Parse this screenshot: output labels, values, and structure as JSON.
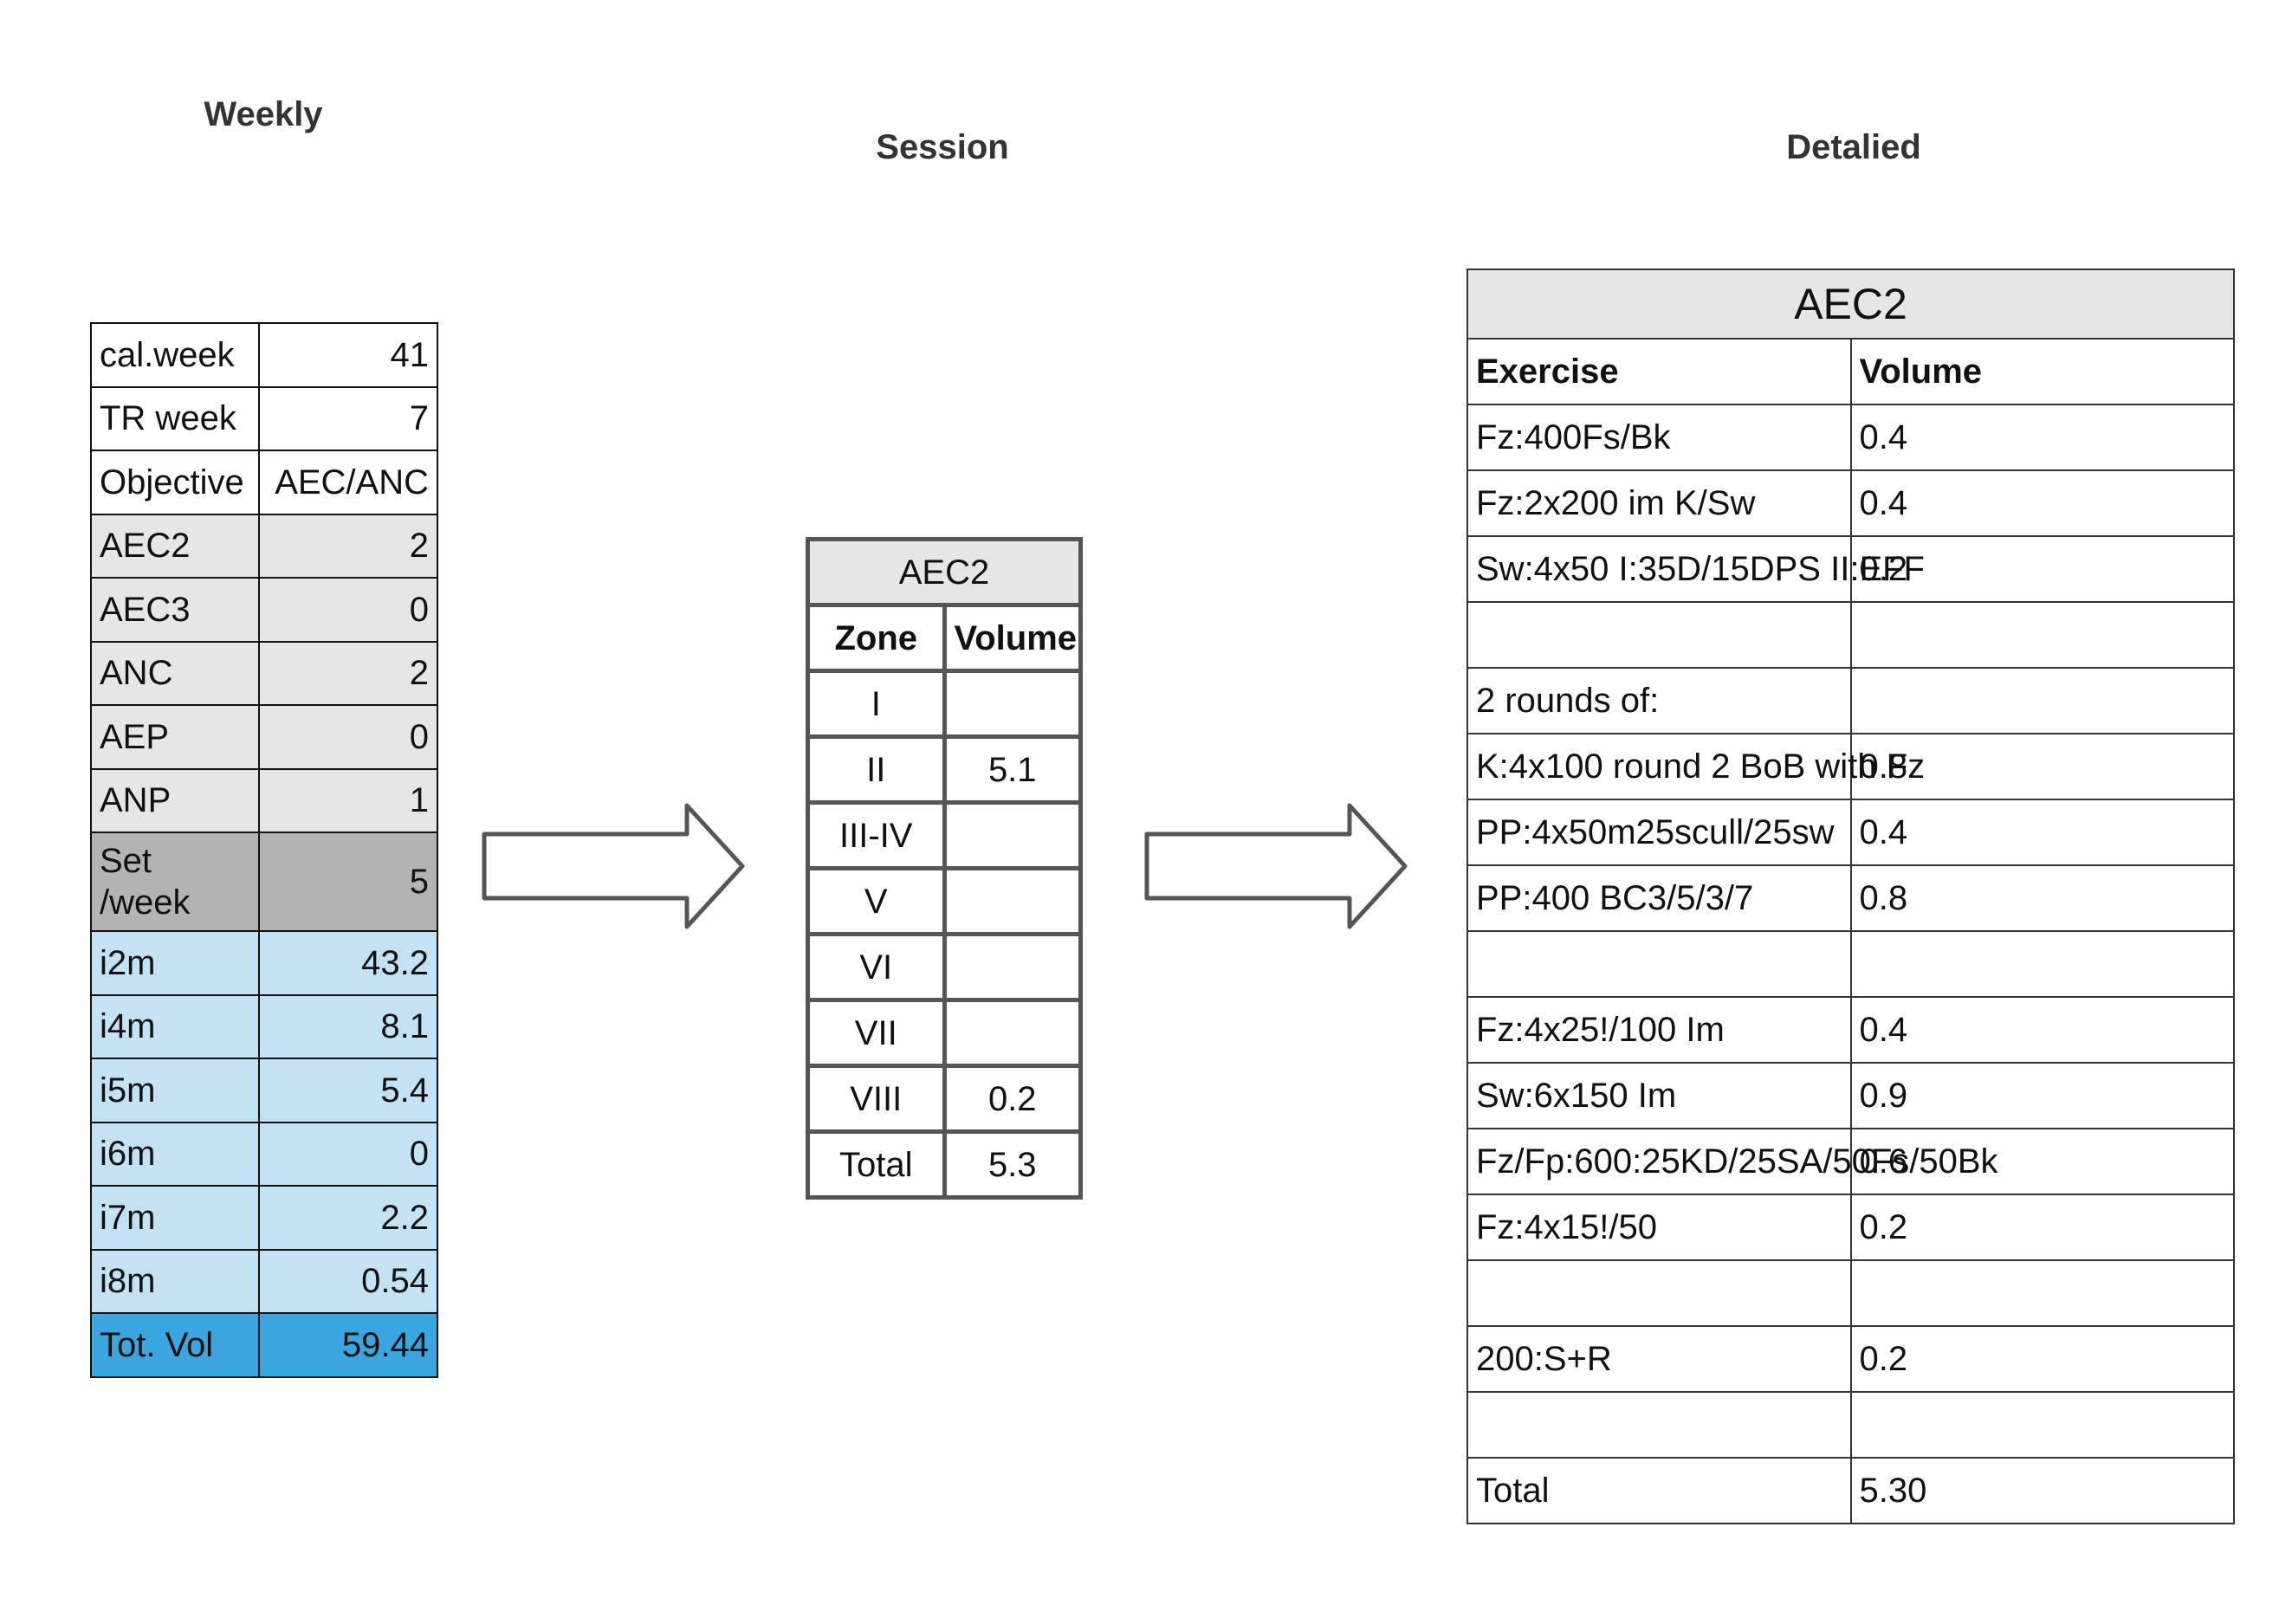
{
  "headings": {
    "weekly": "Weekly",
    "session": "Session",
    "detailed": "Detalied"
  },
  "colors": {
    "light_gray": "#e6e6e6",
    "dark_gray": "#b3b3b3",
    "light_blue": "#c3e3f5",
    "blue": "#3ba5de"
  },
  "weekly": [
    {
      "label": "cal.week",
      "value": "41",
      "style": "white"
    },
    {
      "label": "TR week",
      "value": "7",
      "style": "white"
    },
    {
      "label": "Objective",
      "value": "AEC/ANC",
      "style": "white"
    },
    {
      "label": "AEC2",
      "value": "2",
      "style": "light_gray"
    },
    {
      "label": "AEC3",
      "value": "0",
      "style": "light_gray"
    },
    {
      "label": "ANC",
      "value": "2",
      "style": "light_gray"
    },
    {
      "label": "AEP",
      "value": "0",
      "style": "light_gray"
    },
    {
      "label": "ANP",
      "value": "1",
      "style": "light_gray"
    },
    {
      "label": "Set\n/week",
      "value": "5",
      "style": "dark_gray"
    },
    {
      "label": "i2m",
      "value": "43.2",
      "style": "light_blue"
    },
    {
      "label": "i4m",
      "value": "8.1",
      "style": "light_blue"
    },
    {
      "label": "i5m",
      "value": "5.4",
      "style": "light_blue"
    },
    {
      "label": "i6m",
      "value": "0",
      "style": "light_blue"
    },
    {
      "label": "i7m",
      "value": "2.2",
      "style": "light_blue"
    },
    {
      "label": "i8m",
      "value": "0.54",
      "style": "light_blue"
    },
    {
      "label": "Tot. Vol",
      "value": "59.44",
      "style": "blue"
    }
  ],
  "session": {
    "title": "AEC2",
    "col_zone": "Zone",
    "col_volume": "Volume",
    "rows": [
      {
        "zone": "I",
        "volume": ""
      },
      {
        "zone": "II",
        "volume": "5.1"
      },
      {
        "zone": "III-IV",
        "volume": ""
      },
      {
        "zone": "V",
        "volume": ""
      },
      {
        "zone": "VI",
        "volume": ""
      },
      {
        "zone": "VII",
        "volume": ""
      },
      {
        "zone": "VIII",
        "volume": "0.2"
      },
      {
        "zone": "Total",
        "volume": "5.3"
      }
    ]
  },
  "detailed": {
    "title": "AEC2",
    "col_exercise": "Exercise",
    "col_volume": "Volume",
    "rows": [
      {
        "exercise": "Fz:400Fs/Bk",
        "volume": "0.4"
      },
      {
        "exercise": "Fz:2x200 im K/Sw",
        "volume": "0.4"
      },
      {
        "exercise": "Sw:4x50 I:35D/15DPS II:EFF",
        "volume": "0.2"
      },
      {
        "exercise": "",
        "volume": ""
      },
      {
        "exercise": "2 rounds of:",
        "volume": ""
      },
      {
        "exercise": "K:4x100 round 2 BoB with Fz",
        "volume": "0.8"
      },
      {
        "exercise": "PP:4x50m25scull/25sw",
        "volume": "0.4"
      },
      {
        "exercise": "PP:400 BC3/5/3/7",
        "volume": "0.8"
      },
      {
        "exercise": "",
        "volume": ""
      },
      {
        "exercise": "Fz:4x25!/100 Im",
        "volume": "0.4"
      },
      {
        "exercise": "Sw:6x150 Im",
        "volume": "0.9"
      },
      {
        "exercise": "Fz/Fp:600:25KD/25SA/50Fs/50Bk",
        "volume": "0.6"
      },
      {
        "exercise": "Fz:4x15!/50",
        "volume": "0.2"
      },
      {
        "exercise": "",
        "volume": ""
      },
      {
        "exercise": "200:S+R",
        "volume": "0.2"
      },
      {
        "exercise": "",
        "volume": ""
      },
      {
        "exercise": "Total",
        "volume": "5.30"
      }
    ]
  }
}
